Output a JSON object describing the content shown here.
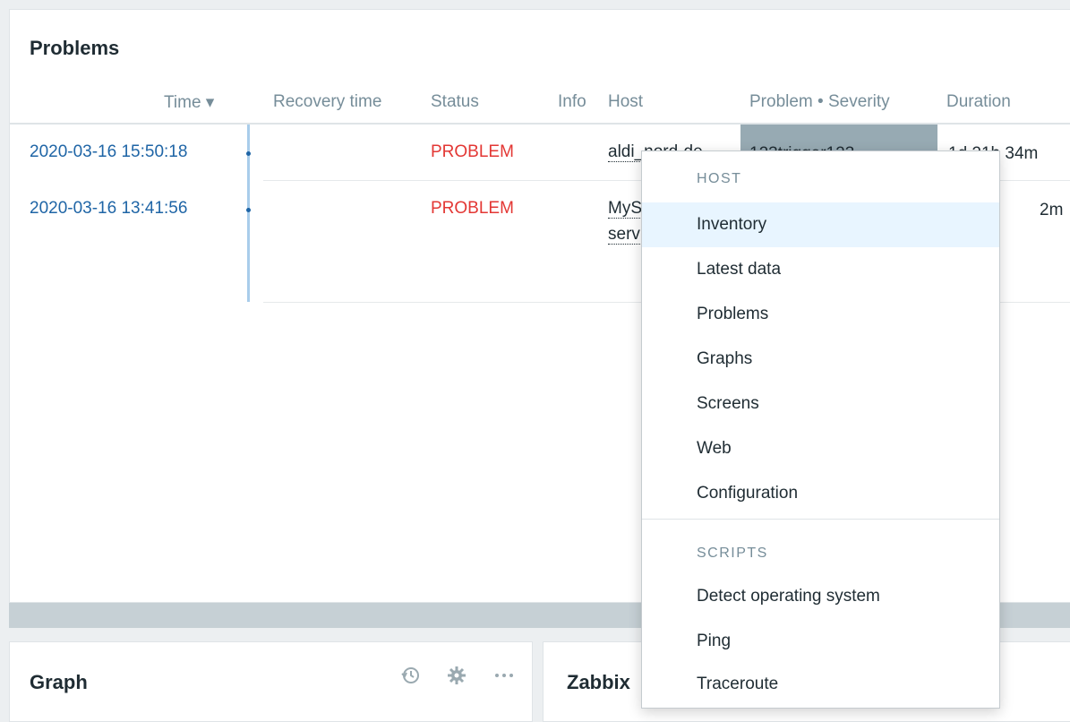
{
  "problems_widget": {
    "title": "Problems",
    "columns": {
      "time": "Time ▾",
      "recovery_time": "Recovery time",
      "status": "Status",
      "info": "Info",
      "host": "Host",
      "problem_severity": "Problem • Severity",
      "duration": "Duration"
    },
    "rows": [
      {
        "time": "2020-03-16 15:50:18",
        "status": "PROBLEM",
        "host": "aldi_nord-de",
        "problem": "123trigger123",
        "duration": "1d 21h 34m"
      },
      {
        "time": "2020-03-16 13:41:56",
        "status": "PROBLEM",
        "host_line1": "MyS",
        "host_line2": "serv",
        "duration_suffix": "2m"
      }
    ]
  },
  "graph_widget": {
    "title": "Graph"
  },
  "zabbix_widget": {
    "title": "Zabbix"
  },
  "context_menu": {
    "host_section": "HOST",
    "host_items": [
      "Inventory",
      "Latest data",
      "Problems",
      "Graphs",
      "Screens",
      "Web",
      "Configuration"
    ],
    "scripts_section": "SCRIPTS",
    "script_items": [
      "Detect operating system",
      "Ping",
      "Traceroute"
    ],
    "highlighted": "Inventory"
  },
  "colors": {
    "link": "#1f65a6",
    "problem": "#e33734",
    "severity_bg": "#97aab3",
    "menu_highlight": "#e8f5ff"
  },
  "icons": [
    "history-icon",
    "gear-icon",
    "more-icon",
    "timeline-dot-icon"
  ]
}
